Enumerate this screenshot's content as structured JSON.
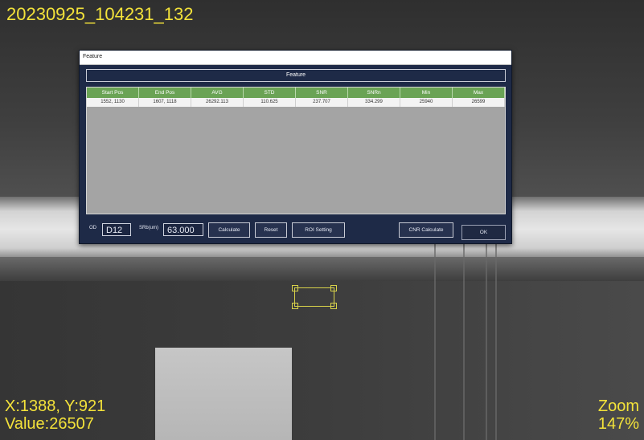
{
  "overlay": {
    "title": "20230925_104231_132",
    "coord": "X:1388, Y:921",
    "value": "Value:26507",
    "zoom_label": "Zoom",
    "zoom_value": "147%"
  },
  "dialog": {
    "title": "Feature",
    "group_header": "Feature",
    "columns": [
      "Start Pos",
      "End Pos",
      "AVG",
      "STD",
      "SNR",
      "SNRn",
      "Min",
      "Max"
    ],
    "rows": [
      [
        "1552, 1130",
        "1607, 1118",
        "26292.113",
        "110.625",
        "237.707",
        "334.299",
        "25940",
        "26599"
      ]
    ],
    "controls": {
      "od_label": "OD",
      "od_value": "D12",
      "srb_label": "SRb(um)",
      "srb_value": "63.000",
      "calculate": "Calculate",
      "reset": "Reset",
      "roi_setting": "ROI Setting",
      "cnr_calculate": "CNR Calculate",
      "ok": "OK"
    }
  },
  "colors": {
    "overlay_text": "#f3e23a",
    "dialog_bg": "#1e2a47",
    "grid_header": "#6aa355",
    "roi": "#d8d24a"
  }
}
